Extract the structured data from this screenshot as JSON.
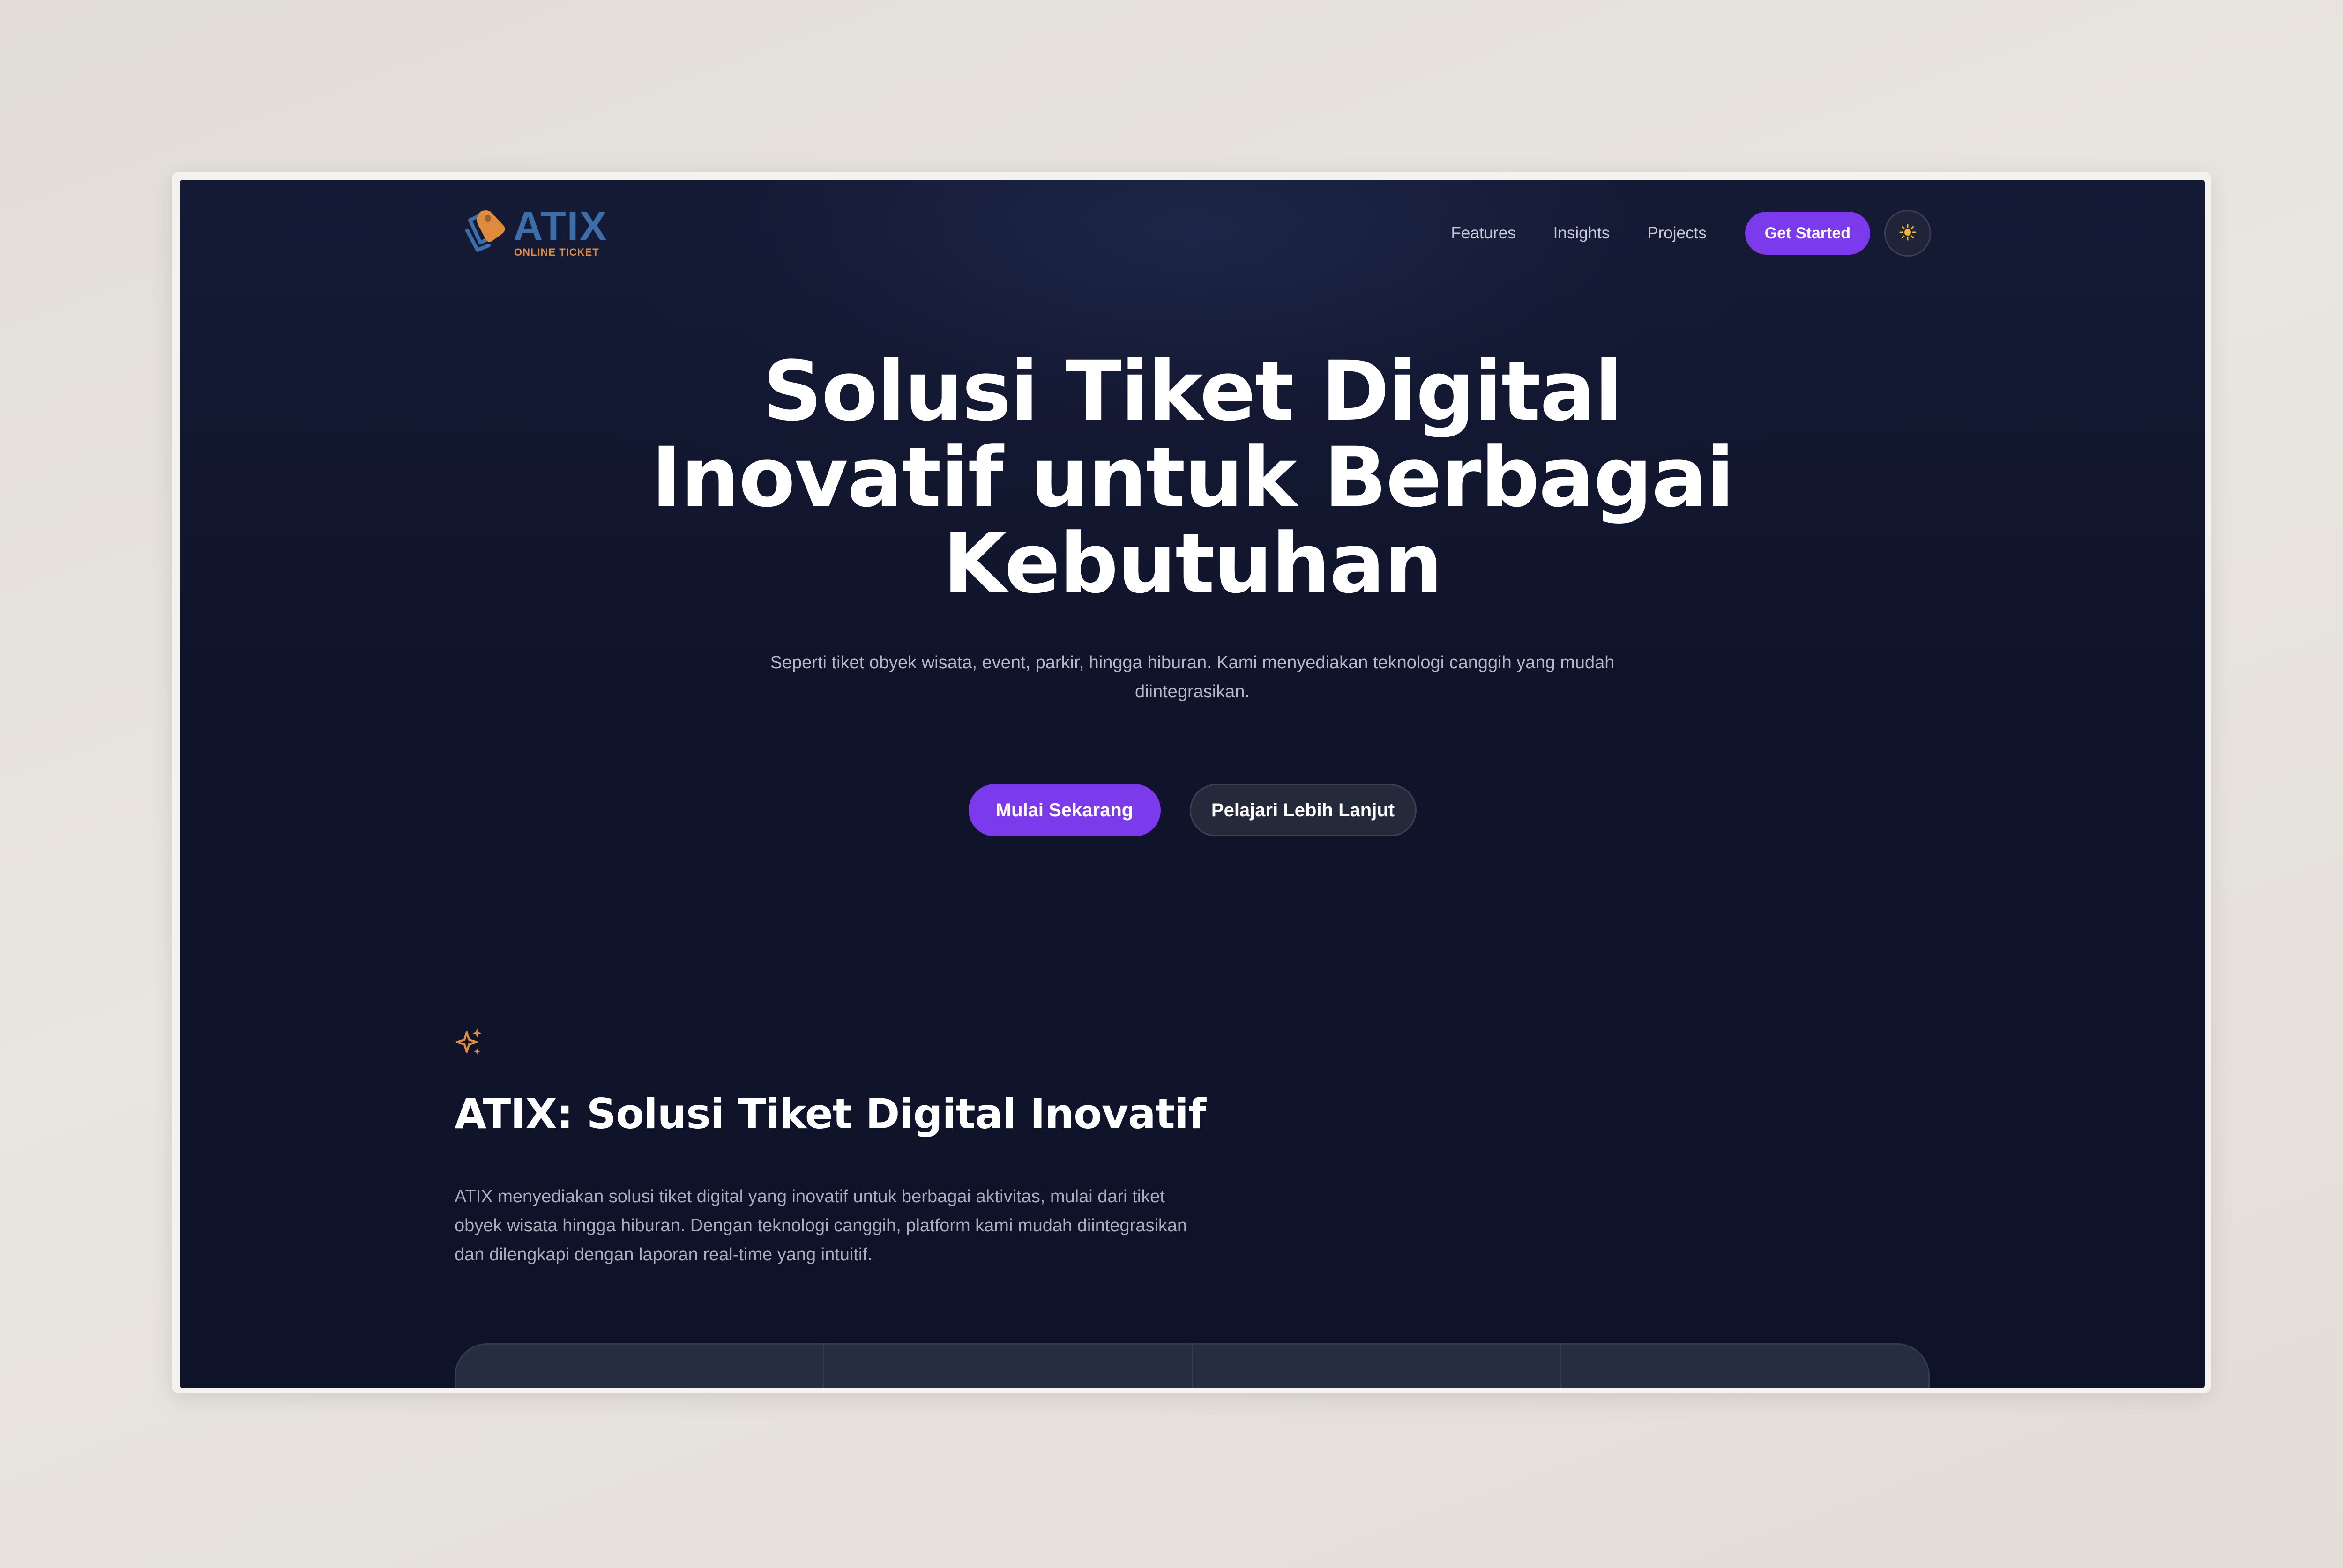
{
  "brand": {
    "name": "ATIX",
    "tagline": "ONLINE TICKET",
    "primary_color": "#3d6ea8",
    "accent_color": "#e08a3c"
  },
  "nav": {
    "links": [
      "Features",
      "Insights",
      "Projects"
    ],
    "cta_label": "Get Started",
    "theme_toggle_icon": "sun-icon"
  },
  "hero": {
    "title_lines": [
      "Solusi Tiket Digital",
      "Inovatif untuk Berbagai",
      "Kebutuhan"
    ],
    "subtitle": "Seperti tiket obyek wisata, event, parkir, hingga hiburan. Kami menyediakan teknologi canggih yang mudah diintegrasikan.",
    "primary_button": "Mulai Sekarang",
    "secondary_button": "Pelajari Lebih Lanjut"
  },
  "about": {
    "icon": "sparkles-icon",
    "title": "ATIX: Solusi Tiket Digital Inovatif",
    "body": "ATIX menyediakan solusi tiket digital yang inovatif untuk berbagai aktivitas, mulai dari tiket obyek wisata hingga hiburan. Dengan teknologi canggih, platform kami mudah diintegrasikan dan dilengkapi dengan laporan real-time yang intuitif."
  },
  "colors": {
    "background": "#10142b",
    "button_primary": "#7c3aed",
    "text_primary": "#ffffff",
    "text_muted": "#b4b9c8"
  }
}
